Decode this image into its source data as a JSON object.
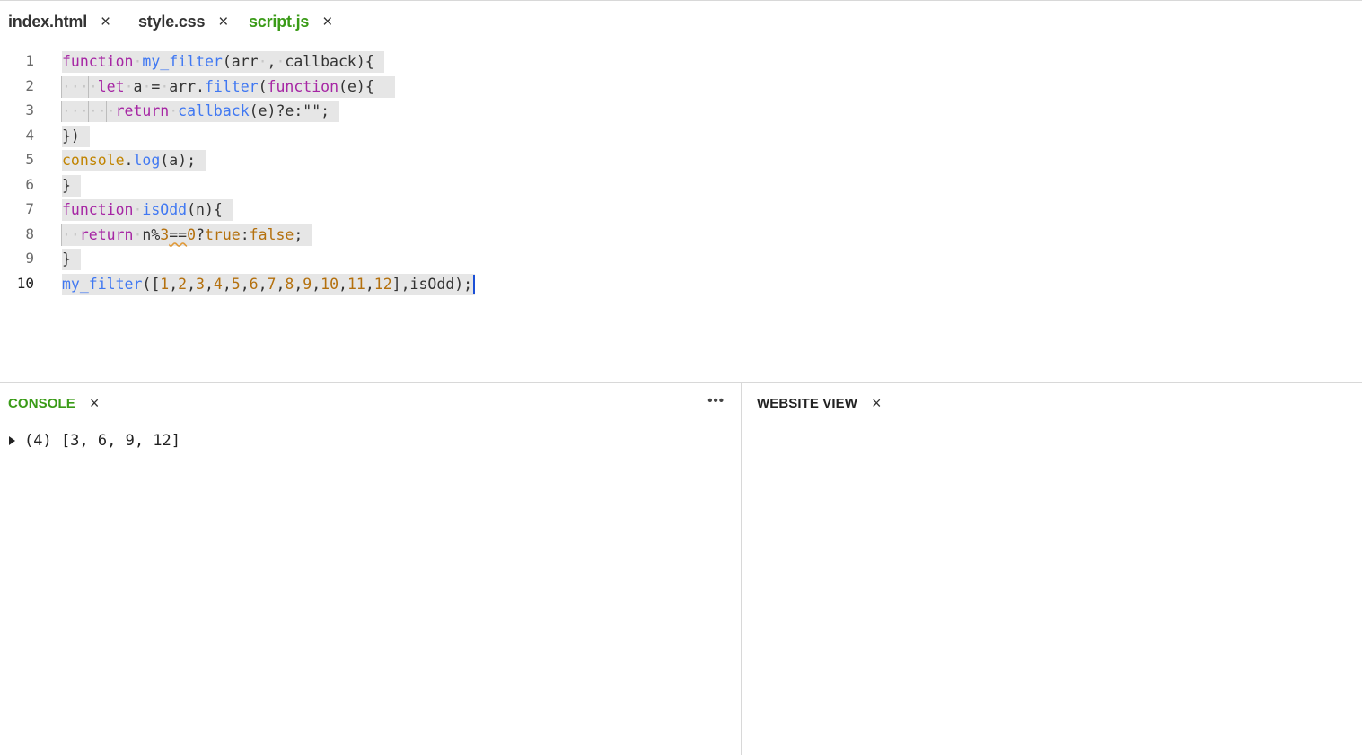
{
  "tabs": [
    {
      "label": "index.html",
      "close": "×",
      "active": false
    },
    {
      "label": "style.css",
      "close": "×",
      "active": false
    },
    {
      "label": "script.js",
      "close": "×",
      "active": true
    }
  ],
  "editor": {
    "line_numbers": [
      "1",
      "2",
      "3",
      "4",
      "5",
      "6",
      "7",
      "8",
      "9",
      "10"
    ],
    "code": {
      "l1": {
        "kw": "function",
        "name": "my_filter",
        "p1": "(arr",
        "p2": ",",
        "p3": "callback){"
      },
      "l2": {
        "kw": "let",
        "var": "a",
        "eq": "=",
        "obj": "arr.",
        "method": "filter",
        "open": "(",
        "kw2": "function",
        "rest": "(e){"
      },
      "l3": {
        "kw": "return",
        "call": "callback",
        "rest": "(e)?e:\"\";"
      },
      "l4": {
        "text": "})"
      },
      "l5": {
        "obj": "console",
        "dot": ".",
        "method": "log",
        "rest": "(a);"
      },
      "l6": {
        "text": "}"
      },
      "l7": {
        "kw": "function",
        "name": "isOdd",
        "rest": "(n){"
      },
      "l8": {
        "kw": "return",
        "a": "n%",
        "n1": "3",
        "op": "==",
        "n2": "0",
        "q": "?",
        "t": "true",
        "c": ":",
        "f": "false",
        "end": ";"
      },
      "l9": {
        "text": "}"
      },
      "l10": {
        "name": "my_filter",
        "open": "([",
        "nums": [
          "1",
          "2",
          "3",
          "4",
          "5",
          "6",
          "7",
          "8",
          "9",
          "10",
          "11",
          "12"
        ],
        "comma": ",",
        "close": "],isOdd);"
      }
    }
  },
  "console": {
    "title": "CONSOLE",
    "close": "×",
    "menu": "•••",
    "output": "(4) [3, 6, 9, 12]"
  },
  "website_view": {
    "title": "WEBSITE VIEW",
    "close": "×"
  }
}
